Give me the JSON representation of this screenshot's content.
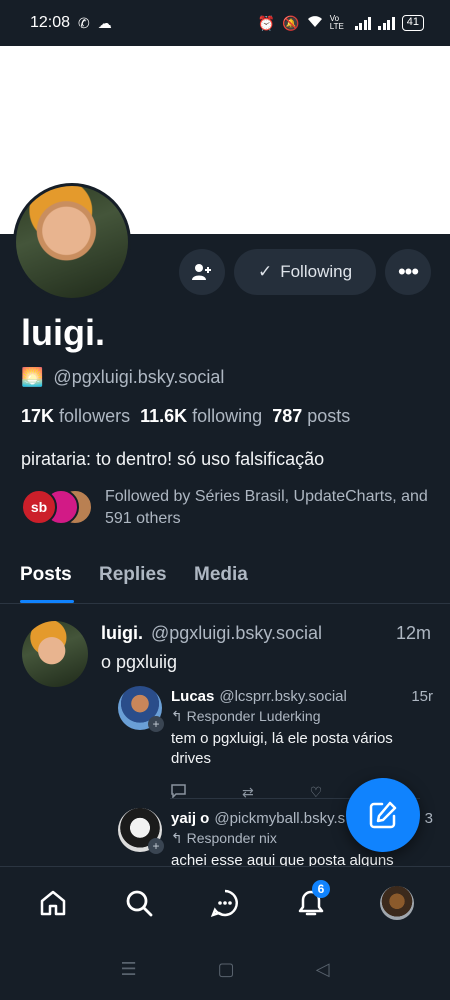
{
  "status_bar": {
    "time": "12:08",
    "network_label": "Vo LTE",
    "battery": "41"
  },
  "profile": {
    "following_label": "Following",
    "display_name": "luigi.",
    "handle": "@pgxluigi.bsky.social",
    "followers_count": "17K",
    "followers_label": "followers",
    "following_count": "11.6K",
    "following_count_label": "following",
    "posts_count": "787",
    "posts_label": "posts",
    "bio": "pirataria: to dentro! só uso falsificação",
    "followed_by": "Followed by Séries Brasil, UpdateCharts, and 591 others",
    "followed_by_avatar_a": "sb"
  },
  "tabs": [
    {
      "label": "Posts",
      "active": true
    },
    {
      "label": "Replies",
      "active": false
    },
    {
      "label": "Media",
      "active": false
    }
  ],
  "post": {
    "author": "luigi.",
    "handle": "@pgxluigi.bsky.social",
    "time": "12m",
    "text": "o pgxluiig"
  },
  "replies": [
    {
      "author": "Lucas",
      "handle": "@lcsprr.bsky.social",
      "time": "15r",
      "reply_to": "Responder Luderking",
      "text": "tem o pgxluigi, lá ele posta vários drives"
    },
    {
      "author": "yaij o",
      "handle": "@pickmyball.bsky.s",
      "time": "3",
      "reply_to": "Responder nix",
      "text": "achei esse aqui que posta alguns"
    }
  ],
  "bottom_nav": {
    "notifications_badge": "6"
  },
  "colors": {
    "background": "#161e27",
    "accent": "#1083fe",
    "surface": "#252f3b",
    "muted_text": "#aeb7c2"
  }
}
